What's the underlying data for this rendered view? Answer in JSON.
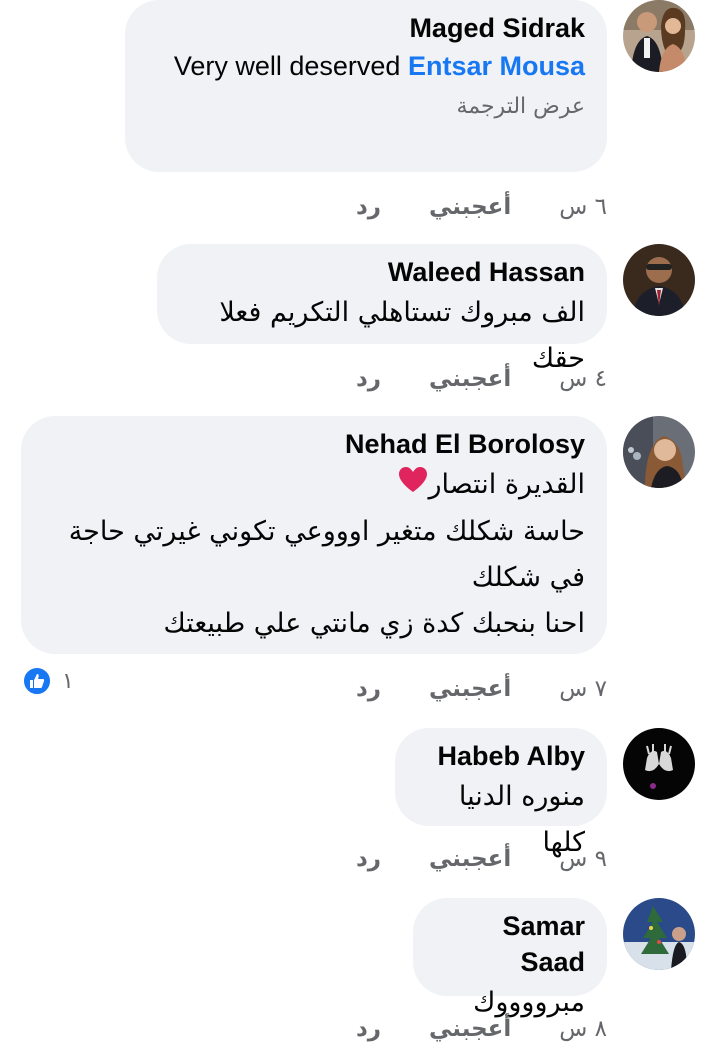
{
  "comments": [
    {
      "author": "Maged Sidrak",
      "text_prefix": "Very well deserved ",
      "mention": "Entsar Mousa",
      "see_translation": "عرض الترجمة",
      "time": "٦ س",
      "like": "أعجبني",
      "reply": "رد"
    },
    {
      "author": "Waleed Hassan",
      "lines": [
        "الف مبروك تستاهلي التكريم  فعلا حقك"
      ],
      "time": "٤ س",
      "like": "أعجبني",
      "reply": "رد"
    },
    {
      "author": "Nehad El Borolosy",
      "lines": [
        "القديرة انتصار",
        "حاسة شكلك متغير اوووعي تكوني غيرتي حاجة",
        "في شكلك",
        "احنا بنحبك كدة زي مانتي علي طبيعتك"
      ],
      "time": "٧ س",
      "like": "أعجبني",
      "reply": "رد",
      "reaction_count": "١",
      "reaction_icon": "thumbs-up-icon",
      "emoji": "heart-icon"
    },
    {
      "author": "Habeb Alby",
      "lines": [
        "منوره الدنيا كلها"
      ],
      "time": "٩ س",
      "like": "أعجبني",
      "reply": "رد"
    },
    {
      "author": "Samar Saad",
      "lines": [
        "مبرووووك"
      ],
      "time": "٨ س",
      "like": "أعجبني",
      "reply": "رد"
    }
  ],
  "colors": {
    "bubble": "#f0f2f5",
    "mention": "#1877f2",
    "meta": "#65676b",
    "like_badge": "#1877f2",
    "heart": "#e0245e"
  }
}
